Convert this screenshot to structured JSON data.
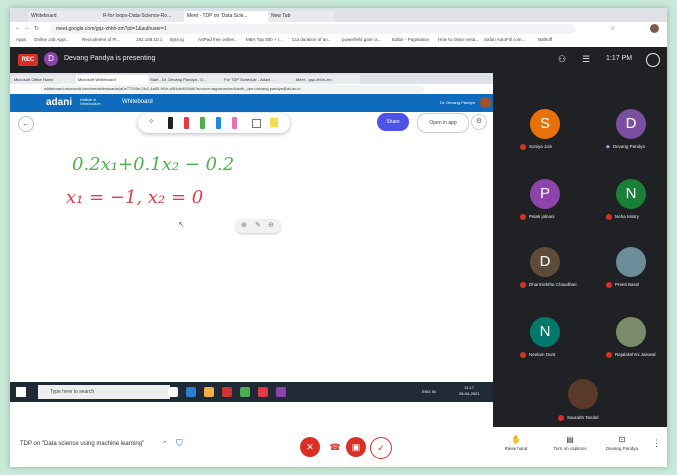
{
  "outer_tabs": [
    "Whiteboard",
    "R-for loops-Data-Science-Ro...",
    "Meet - TDP on 'Data Scie...",
    "New Tab"
  ],
  "outer_url": "meet.google.com/gqz-xhhh-zm?pli=1&authuser=1",
  "bookmarks": [
    "Apps",
    "Online Job Appl...",
    "Recruitment of Pi...",
    "192.168.10.1",
    "Byte.ig",
    "ArtPad free online...",
    "MBA Top 200 + I...",
    "Cut duration of an...",
    "powerfield gann a...",
    "Editor - Pagination",
    "How to clean meta...",
    "Safari AutoFill com...",
    "Bathoff"
  ],
  "recording": {
    "badge": "REC"
  },
  "presenter": {
    "initial": "D",
    "text": "Devang Pandya is presenting"
  },
  "top_time": "1:17 PM",
  "inner_tabs": [
    "Microsoft Office Home",
    "Microsoft Whiteboard",
    "Start - Dr. Devang Pandya - O...",
    "For TDP Schedule - Adani ...",
    "Meet - gqz-xhhh-zm"
  ],
  "inner_url": "whiteboard.microsoft.com/me/whiteboards/a0e77255e-2fc2-4a55-9f1b-d0f1db9034d0?source=applauncher&auth_upn=devang.pandya@aii.ac.in",
  "whiteboard": {
    "logo": "adani",
    "logo_sub": "Institute of Infrastructure",
    "title": "Whiteboard",
    "user": "Dr. Devang Pandya",
    "share": "Share",
    "open_app": "Open in app",
    "eq1": "0.2x₁+0.1x₂ − 0.2",
    "eq2": "x₁ = −1, x₂ = 0"
  },
  "taskbar": {
    "search": "Type here to search",
    "time": "11:17",
    "date": "28-04-2021",
    "lang": "ENG IN"
  },
  "participants": [
    {
      "initial": "S",
      "name": "Soniya Jain",
      "color": "#e8710a",
      "muted": true
    },
    {
      "initial": "D",
      "name": "Devang Pandya",
      "color": "#7b4fa0",
      "muted": false
    },
    {
      "initial": "P",
      "name": "Palak jalnani",
      "color": "#8e44ad",
      "muted": true
    },
    {
      "initial": "N",
      "name": "Neha Mistry",
      "color": "#188038",
      "muted": true
    },
    {
      "initial": "D",
      "name": "Dharmishtha Chaudhari",
      "color": "#5f4b3a",
      "muted": true
    },
    {
      "initial": "",
      "name": "Preeti Basel",
      "color": "#6b8e9a",
      "muted": true
    },
    {
      "initial": "N",
      "name": "Neelam Dunt",
      "color": "#00796b",
      "muted": true
    },
    {
      "initial": "",
      "name": "Rajalakshmi Jaiswal",
      "color": "#7d8a6a",
      "muted": true
    },
    {
      "initial": "",
      "name": "Saurabh Tandel",
      "color": "#5a3a2a",
      "muted": true
    }
  ],
  "bottom": {
    "meeting_name": "TDP on \"Data science using machine learning\"",
    "raise_hand": "Raise hand",
    "captions": "Turn on captions",
    "presenting": "Devang Pandya"
  }
}
